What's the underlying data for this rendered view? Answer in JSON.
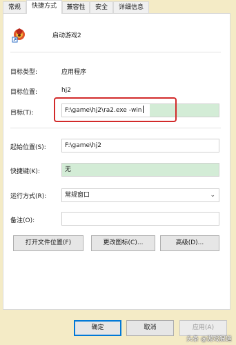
{
  "tabs": [
    {
      "label": "常规"
    },
    {
      "label": "快捷方式"
    },
    {
      "label": "兼容性"
    },
    {
      "label": "安全"
    },
    {
      "label": "详细信息"
    }
  ],
  "shortcut": {
    "name": "启动游戏2",
    "icon": "game-app-icon"
  },
  "fields": {
    "target_type_label": "目标类型:",
    "target_type_value": "应用程序",
    "target_location_label": "目标位置:",
    "target_location_value": "hj2",
    "target_label": "目标(T):",
    "target_value": "F:\\game\\hj2\\ra2.exe -win",
    "start_in_label": "起始位置(S):",
    "start_in_value": "F:\\game\\hj2",
    "hotkey_label": "快捷键(K):",
    "hotkey_value": "无",
    "run_label": "运行方式(R):",
    "run_value": "常规窗口",
    "comment_label": "备注(O):",
    "comment_value": ""
  },
  "buttons": {
    "open_location": "打开文件位置(F)",
    "change_icon": "更改图标(C)...",
    "advanced": "高级(D)..."
  },
  "footer": {
    "ok": "确定",
    "cancel": "取消",
    "apply": "应用(A)"
  },
  "watermark": "头条 @游戏狠道",
  "colors": {
    "highlight_box": "#d22a2a",
    "field_green": "#d3ecd6",
    "background": "#f4ebc6"
  }
}
